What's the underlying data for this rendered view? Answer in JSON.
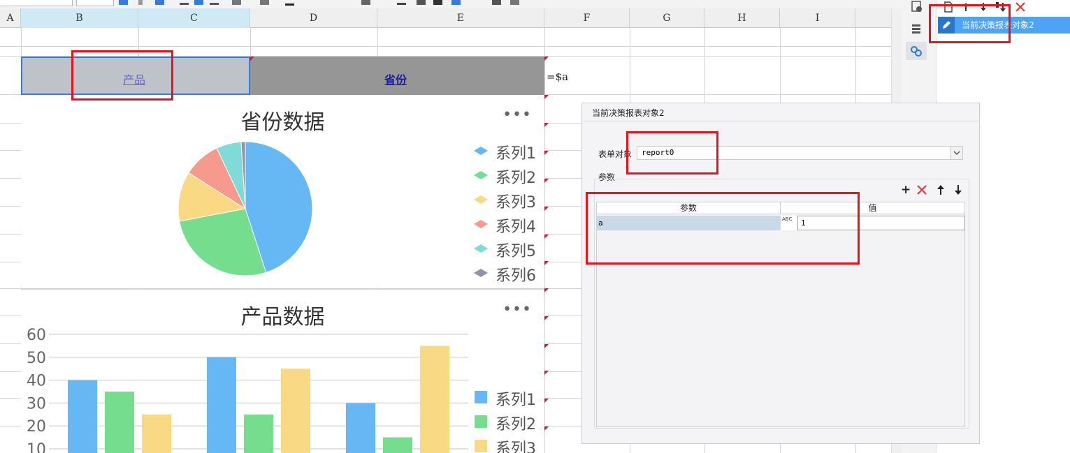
{
  "column_headers": [
    "A",
    "B",
    "C",
    "D",
    "E",
    "F",
    "G",
    "H",
    "I"
  ],
  "cells": {
    "product_header": "产品",
    "province_header": "省份",
    "formula": "=$a"
  },
  "pie_chart": {
    "title": "省份数据",
    "more": "•••",
    "legend": [
      "系列1",
      "系列2",
      "系列3",
      "系列4",
      "系列5",
      "系列6"
    ]
  },
  "bar_chart": {
    "title": "产品数据",
    "more": "•••",
    "legend": [
      "系列1",
      "系列2",
      "系列3"
    ],
    "y_ticks": [
      "60",
      "50",
      "40",
      "30",
      "20",
      "10"
    ]
  },
  "chart_data": [
    {
      "type": "pie",
      "title": "省份数据",
      "categories": [
        "系列1",
        "系列2",
        "系列3",
        "系列4",
        "系列5",
        "系列6"
      ],
      "values": [
        45,
        27,
        12,
        9,
        6,
        1
      ],
      "colors": [
        "#66b8f5",
        "#74dd8e",
        "#f9d983",
        "#f79a8e",
        "#7fdad8",
        "#8f94a8"
      ],
      "legend_position": "right"
    },
    {
      "type": "bar",
      "title": "产品数据",
      "categories": [
        "",
        "",
        ""
      ],
      "series": [
        {
          "name": "系列1",
          "values": [
            40,
            50,
            30
          ],
          "color": "#66b8f5"
        },
        {
          "name": "系列2",
          "values": [
            35,
            25,
            15
          ],
          "color": "#74dd8e"
        },
        {
          "name": "系列3",
          "values": [
            25,
            45,
            55
          ],
          "color": "#f9d983"
        }
      ],
      "ylim": [
        0,
        60
      ],
      "grid": true,
      "legend_position": "right"
    }
  ],
  "object_list": {
    "item_label": "当前决策报表对象2"
  },
  "dialog": {
    "title": "当前决策报表对象2",
    "form_label": "表单对象",
    "form_value": "report0",
    "params_group_label": "参数",
    "table_headers": [
      "参数",
      "值"
    ],
    "rows": [
      {
        "name": "a",
        "type_label": "ABC",
        "value": "1"
      }
    ]
  },
  "colors": {
    "selection_blue": "#2e7ee6",
    "highlight_red": "#e3161d",
    "item_blue": "#4fa3f5"
  }
}
